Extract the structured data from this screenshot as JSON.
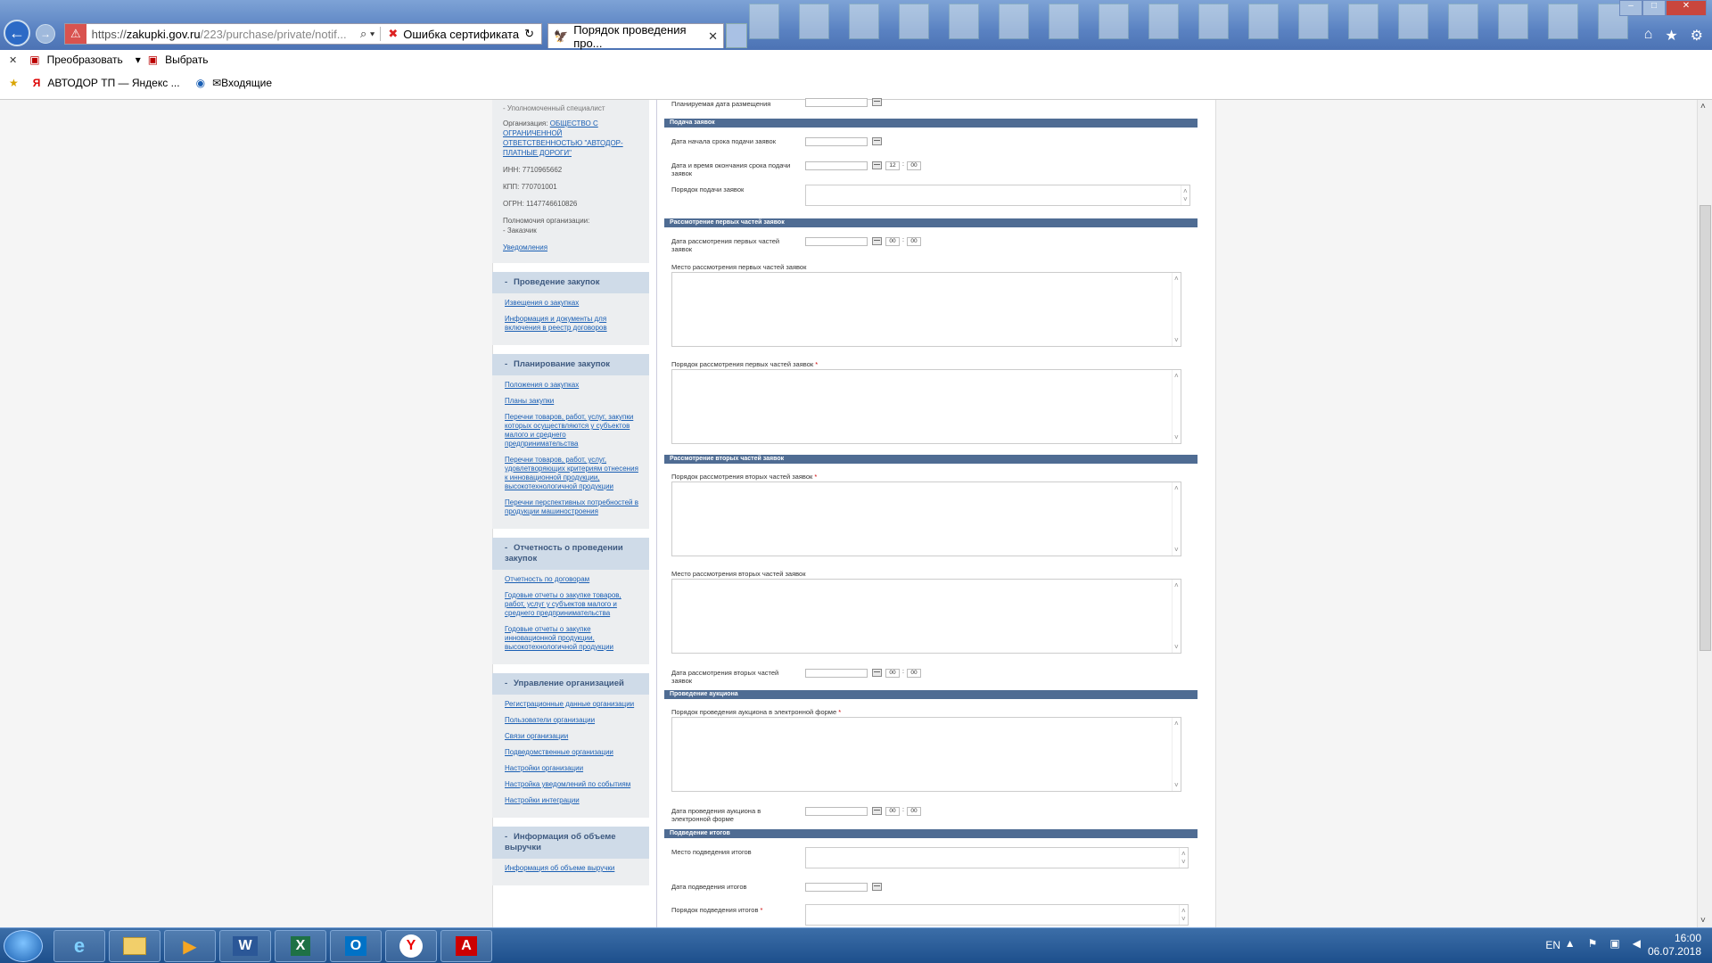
{
  "browser": {
    "address": {
      "cert_label": "",
      "url_prefix": "https://",
      "url_host": "zakupki.gov.ru",
      "url_rest": "/223/purchase/private/notif...",
      "cert_error": "Ошибка сертификата"
    },
    "active_tab": "Порядок проведения про...",
    "tab_close": "✕",
    "command_bar": {
      "close": "✕",
      "convert": "Преобразовать",
      "select": "Выбрать"
    },
    "favorites": {
      "item1": "АВТОДОР ТП — Яндекс ...",
      "item2": "✉Входящие"
    }
  },
  "sidebar": {
    "top": {
      "role_line": "- Уполномоченный специалист",
      "org_label": "Организация:",
      "org_link": "ОБЩЕСТВО С ОГРАНИЧЕННОЙ ОТВЕТСТВЕННОСТЬЮ \"АВТОДОР-ПЛАТНЫЕ ДОРОГИ\"",
      "inn": "ИНН: 7710965662",
      "kpp": "КПП: 770701001",
      "ogrn": "ОГРН: 1147746610826",
      "powers_label": "Полномочия организации:",
      "powers_value": "- Заказчик",
      "notifications": "Уведомления"
    },
    "blocks": [
      {
        "title": "Проведение закупок",
        "links": [
          "Извещения о закупках",
          "Информация и документы для включения в реестр договоров"
        ]
      },
      {
        "title": "Планирование закупок",
        "links": [
          "Положения о закупках",
          "Планы закупки",
          "Перечни товаров, работ, услуг, закупки которых осуществляются у субъектов малого и среднего предпринимательства",
          "Перечни товаров, работ, услуг, удовлетворяющих критериям отнесения к инновационной продукции, высокотехнологичной продукции",
          "Перечни перспективных потребностей в продукции машиностроения"
        ]
      },
      {
        "title": "Отчетность о проведении закупок",
        "links": [
          "Отчетность по договорам",
          "Годовые отчеты о закупке товаров, работ, услуг у субъектов малого и среднего предпринимательства",
          "Годовые отчеты о закупке инновационной продукции, высокотехнологичной продукции"
        ]
      },
      {
        "title": "Управление организацией",
        "links": [
          "Регистрационные данные организации",
          "Пользователи организации",
          "Связи организации",
          "Подведомственные организации",
          "Настройки организации",
          "Настройка уведомлений по событиям",
          "Настройки интеграции"
        ]
      },
      {
        "title": "Информация об объеме выручки",
        "links": [
          "Информация об объеме выручки"
        ]
      }
    ]
  },
  "form": {
    "planned_date": "Планируемая дата размещения",
    "sections": {
      "submission": "Подача заявок",
      "first_parts": "Рассмотрение первых частей заявок",
      "second_parts": "Рассмотрение вторых частей заявок",
      "auction": "Проведение аукциона",
      "results": "Подведение итогов"
    },
    "submission_start": "Дата начала срока подачи заявок",
    "submission_end": "Дата и время окончания срока подачи заявок",
    "submission_end_hour": "12",
    "submission_end_min": "00",
    "submission_order": "Порядок подачи заявок",
    "first_date": "Дата рассмотрения первых частей заявок",
    "first_hour": "00",
    "first_min": "00",
    "first_place": "Место рассмотрения первых частей заявок",
    "first_order": "Порядок рассмотрения первых частей заявок",
    "second_order": "Порядок рассмотрения вторых частей заявок",
    "second_place": "Место рассмотрения вторых частей заявок",
    "second_date": "Дата рассмотрения вторых частей заявок",
    "second_hour": "00",
    "second_min": "00",
    "auction_order": "Порядок проведения аукциона в электронной форме",
    "auction_date": "Дата проведения аукциона в электронной форме",
    "auction_hour": "00",
    "auction_min": "00",
    "results_place": "Место подведения итогов",
    "results_date": "Дата подведения итогов",
    "results_order": "Порядок подведения итогов",
    "required_mark": "*"
  },
  "taskbar": {
    "lang": "EN",
    "time": "16:00",
    "date": "06.07.2018"
  }
}
